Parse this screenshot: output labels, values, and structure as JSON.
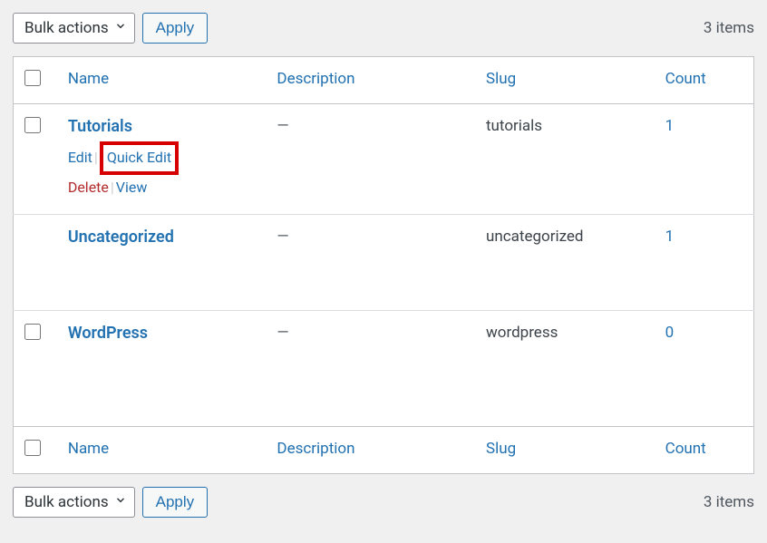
{
  "toolbar": {
    "bulk_label": "Bulk actions",
    "apply_label": "Apply",
    "items_count": "3 items"
  },
  "columns": {
    "name": "Name",
    "description": "Description",
    "slug": "Slug",
    "count": "Count"
  },
  "rows": [
    {
      "name": "Tutorials",
      "description": "—",
      "slug": "tutorials",
      "count": "1",
      "actions": {
        "edit": "Edit",
        "quick_edit": "Quick Edit",
        "delete": "Delete",
        "view": "View"
      }
    },
    {
      "name": "Uncategorized",
      "description": "—",
      "slug": "uncategorized",
      "count": "1"
    },
    {
      "name": "WordPress",
      "description": "—",
      "slug": "wordpress",
      "count": "0"
    }
  ]
}
